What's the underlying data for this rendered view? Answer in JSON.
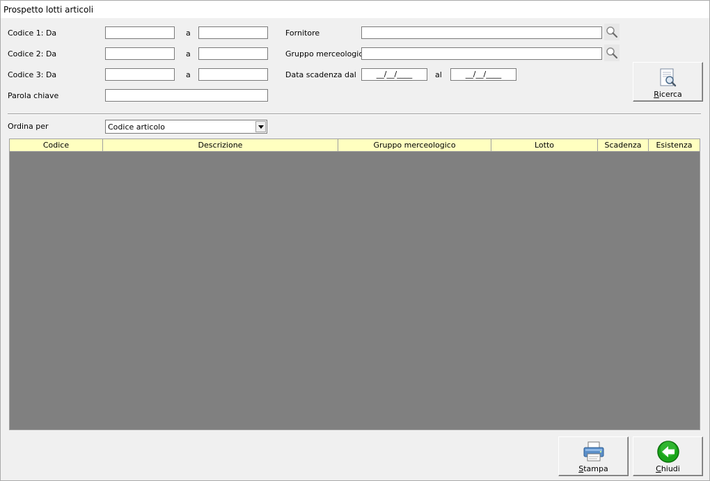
{
  "window": {
    "title": "Prospetto lotti articoli"
  },
  "filters": {
    "codice1_label": "Codice 1: Da",
    "codice2_label": "Codice 2: Da",
    "codice3_label": "Codice 3: Da",
    "to_label": "a",
    "parola_chiave_label": "Parola chiave",
    "fornitore_label": "Fornitore",
    "gruppo_label": "Gruppo merceologico",
    "data_scadenza_label": "Data scadenza dal",
    "al_label": "al",
    "date_from_value": "__/__/____",
    "date_to_value": "__/__/____"
  },
  "sort": {
    "label": "Ordina per",
    "selected": "Codice articolo"
  },
  "buttons": {
    "ricerca_accel": "R",
    "ricerca_rest": "icerca",
    "stampa_accel": "S",
    "stampa_rest": "tampa",
    "chiudi_accel": "C",
    "chiudi_rest": "hiudi"
  },
  "table": {
    "columns": [
      "Codice",
      "Descrizione",
      "Gruppo merceologico",
      "Lotto",
      "Scadenza",
      "Esistenza"
    ]
  },
  "colors": {
    "header_bg": "#ffffc0",
    "grid_bg": "#808080",
    "chiudi_green": "#1aa51a"
  }
}
